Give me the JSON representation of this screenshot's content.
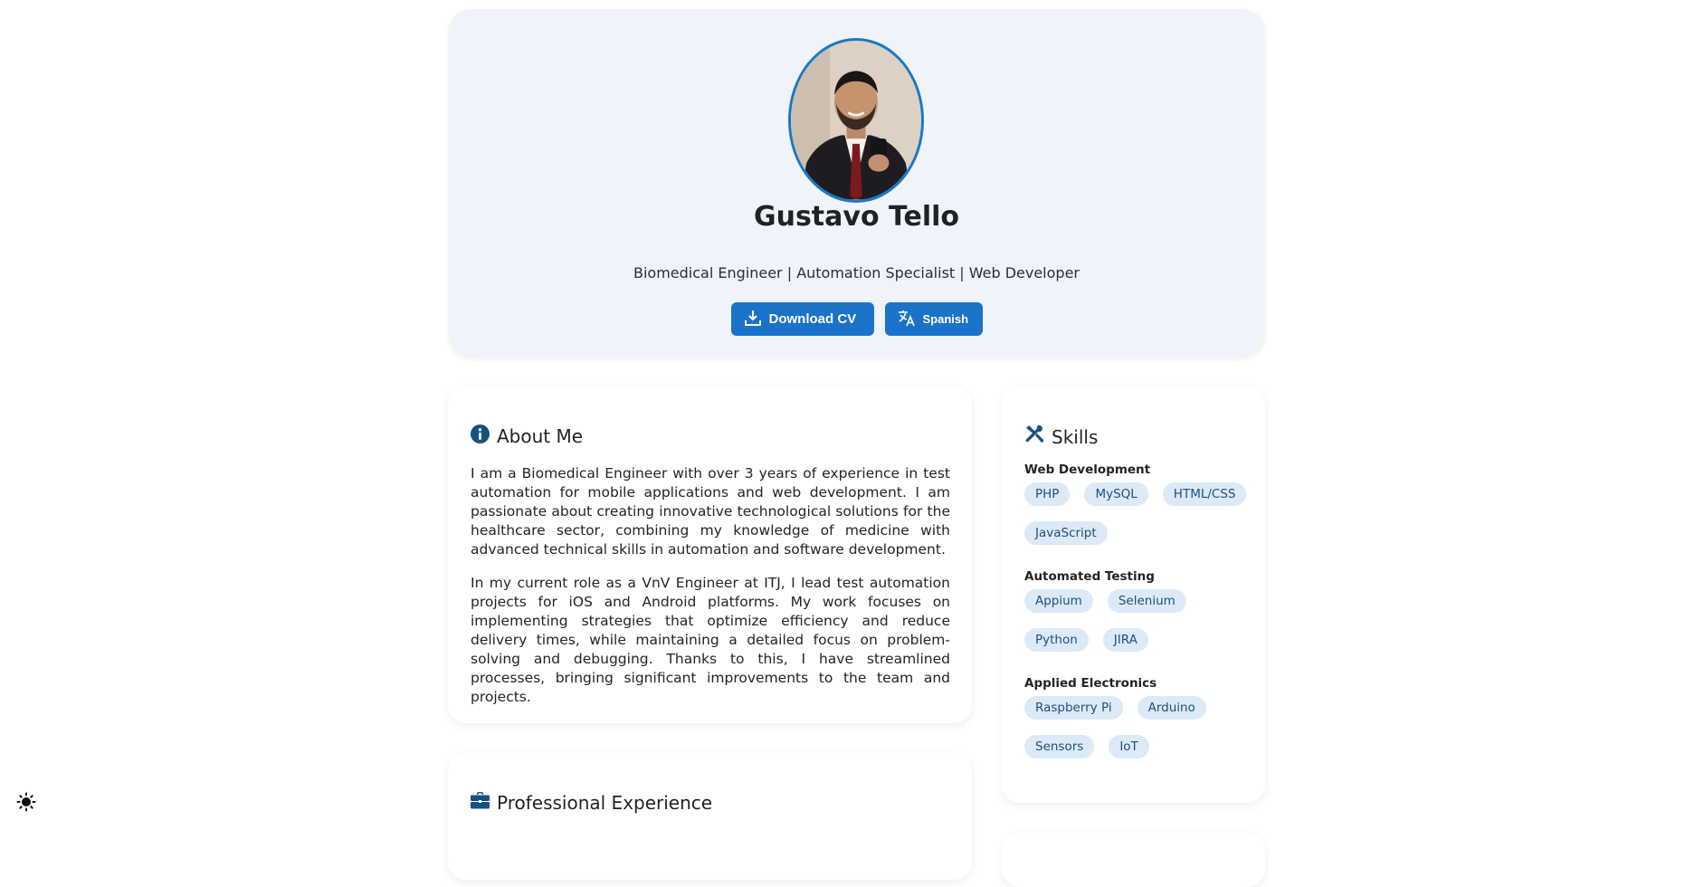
{
  "header": {
    "name": "Gustavo Tello",
    "subtitle": "Biomedical Engineer | Automation Specialist | Web Developer",
    "download_label": "Download CV",
    "language_label": "Spanish"
  },
  "about": {
    "title": "About Me",
    "paragraphs": [
      "I am a Biomedical Engineer with over 3 years of experience in test automation for mobile applications and web development. I am passionate about creating innovative technological solutions for the healthcare sector, combining my knowledge of medicine with advanced technical skills in automation and software development.",
      "In my current role as a VnV Engineer at ITJ, I lead test automation projects for iOS and Android platforms. My work focuses on implementing strategies that optimize efficiency and reduce delivery times, while maintaining a detailed focus on problem-solving and debugging. Thanks to this, I have streamlined processes, bringing significant improvements to the team and projects."
    ]
  },
  "skills": {
    "title": "Skills",
    "groups": [
      {
        "title": "Web Development",
        "tags": [
          "PHP",
          "MySQL",
          "HTML/CSS",
          "JavaScript"
        ]
      },
      {
        "title": "Automated Testing",
        "tags": [
          "Appium",
          "Selenium",
          "Python",
          "JIRA"
        ]
      },
      {
        "title": "Applied Electronics",
        "tags": [
          "Raspberry Pi",
          "Arduino",
          "Sensors",
          "IoT"
        ]
      }
    ]
  },
  "experience": {
    "title": "Professional Experience"
  },
  "icons": {
    "about": "info-circle-icon",
    "skills": "tools-icon",
    "experience": "briefcase-icon",
    "download": "download-icon",
    "language": "translate-icon",
    "theme": "sun-icon"
  },
  "colors": {
    "accent": "#1a73c8",
    "header_bg": "#eef4fa",
    "tag_bg": "#dbeaf6",
    "tag_text": "#1f4f7c",
    "icon_dark": "#18507e"
  }
}
